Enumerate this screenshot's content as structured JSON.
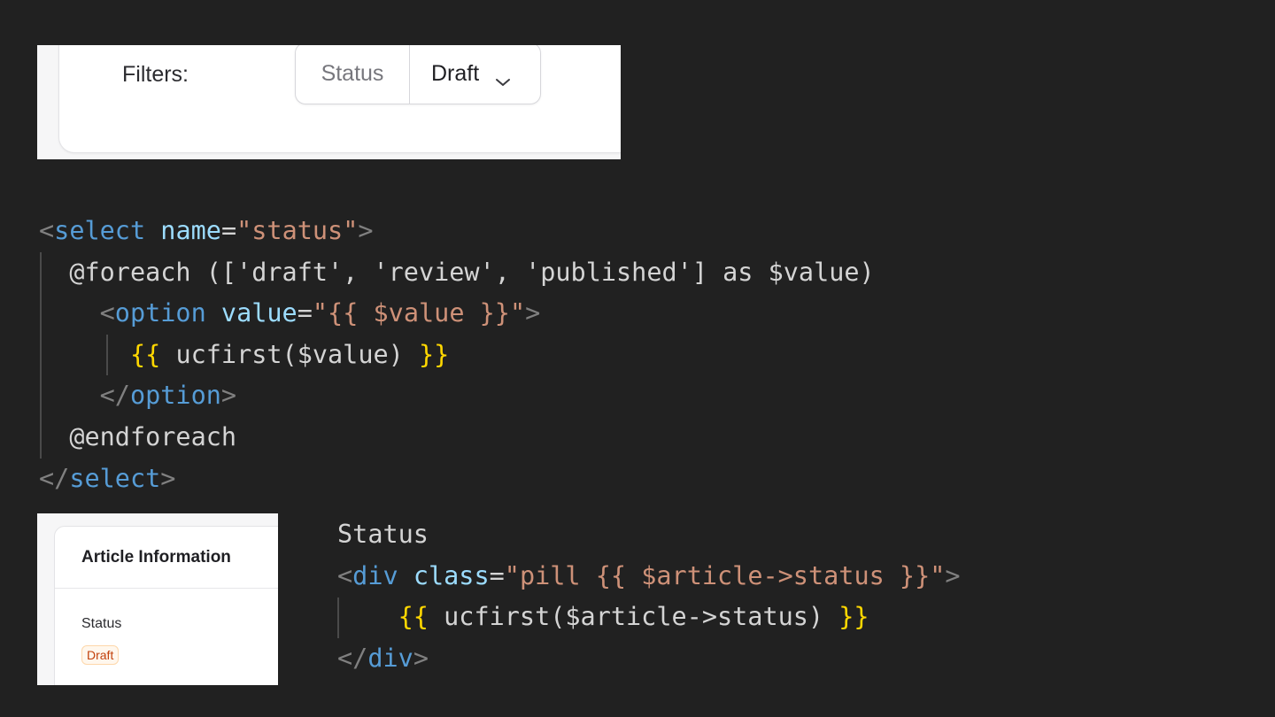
{
  "filters_panel": {
    "label": "Filters:",
    "filter_key": "Status",
    "filter_value": "Draft",
    "dropdown_icon": "chevron-down-icon"
  },
  "select_code": {
    "lines": [
      [
        {
          "t": "<",
          "c": "punct"
        },
        {
          "t": "select",
          "c": "tag"
        },
        {
          "t": " ",
          "c": "plain"
        },
        {
          "t": "name",
          "c": "attr"
        },
        {
          "t": "=",
          "c": "plain"
        },
        {
          "t": "\"status\"",
          "c": "str"
        },
        {
          "t": ">",
          "c": "punct"
        }
      ],
      [
        {
          "t": "  @foreach (['draft', 'review', 'published'] as $value)",
          "c": "plain"
        }
      ],
      [
        {
          "t": "    <",
          "c": "punct"
        },
        {
          "t": "option",
          "c": "tag"
        },
        {
          "t": " ",
          "c": "plain"
        },
        {
          "t": "value",
          "c": "attr"
        },
        {
          "t": "=",
          "c": "plain"
        },
        {
          "t": "\"{{ $value }}\"",
          "c": "str"
        },
        {
          "t": ">",
          "c": "punct"
        }
      ],
      [
        {
          "t": "      ",
          "c": "plain"
        },
        {
          "t": "{{",
          "c": "brace"
        },
        {
          "t": " ucfirst($value) ",
          "c": "plain"
        },
        {
          "t": "}}",
          "c": "brace"
        }
      ],
      [
        {
          "t": "    </",
          "c": "punct"
        },
        {
          "t": "option",
          "c": "tag"
        },
        {
          "t": ">",
          "c": "punct"
        }
      ],
      [
        {
          "t": "  @endforeach",
          "c": "plain"
        }
      ],
      [
        {
          "t": "</",
          "c": "punct"
        },
        {
          "t": "select",
          "c": "tag"
        },
        {
          "t": ">",
          "c": "punct"
        }
      ]
    ]
  },
  "status_code": {
    "lines": [
      [
        {
          "t": "Status",
          "c": "plain"
        }
      ],
      [
        {
          "t": "<",
          "c": "punct"
        },
        {
          "t": "div",
          "c": "tag"
        },
        {
          "t": " ",
          "c": "plain"
        },
        {
          "t": "class",
          "c": "attr"
        },
        {
          "t": "=",
          "c": "plain"
        },
        {
          "t": "\"pill {{ $article->status }}\"",
          "c": "str"
        },
        {
          "t": ">",
          "c": "punct"
        }
      ],
      [
        {
          "t": "    ",
          "c": "plain"
        },
        {
          "t": "{{",
          "c": "brace"
        },
        {
          "t": " ucfirst($article->status) ",
          "c": "plain"
        },
        {
          "t": "}}",
          "c": "brace"
        }
      ],
      [
        {
          "t": "</",
          "c": "punct"
        },
        {
          "t": "div",
          "c": "tag"
        },
        {
          "t": ">",
          "c": "punct"
        }
      ]
    ]
  },
  "article_panel": {
    "title": "Article Information",
    "status_label": "Status",
    "status_value": "Draft"
  },
  "colors": {
    "background": "#212121",
    "tag": "#569cd6",
    "attribute": "#9cdcfe",
    "string": "#ce9178",
    "brace": "#ffd700",
    "draft_pill_text": "#c2410c"
  }
}
